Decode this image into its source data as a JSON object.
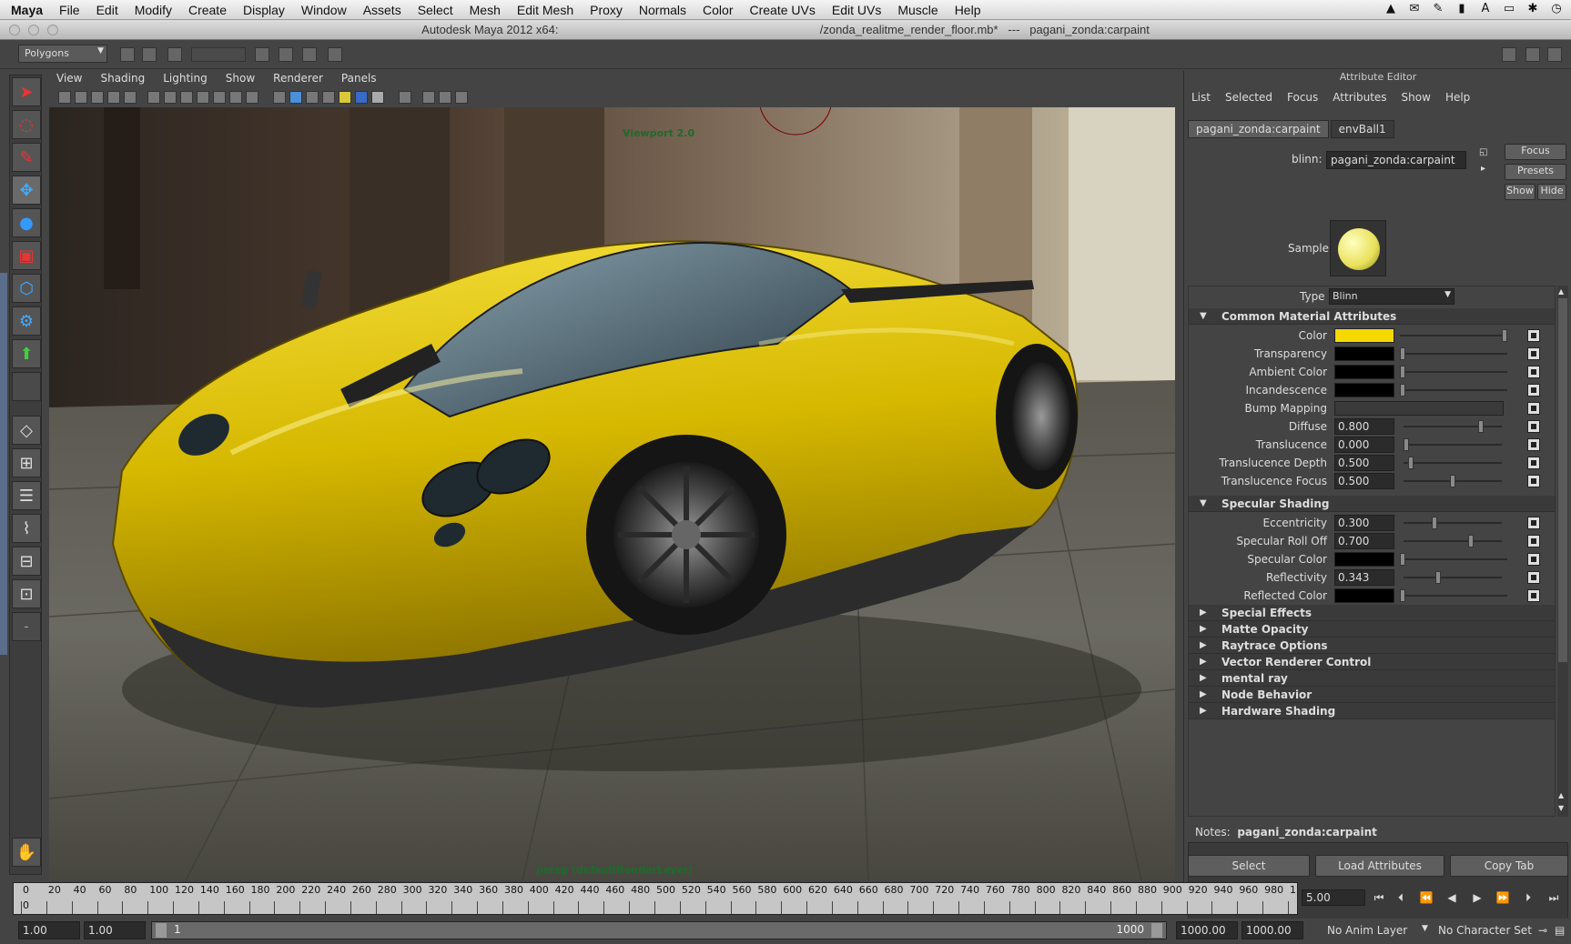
{
  "menubar": {
    "app": "Maya",
    "items": [
      "File",
      "Edit",
      "Modify",
      "Create",
      "Display",
      "Window",
      "Assets",
      "Select",
      "Mesh",
      "Edit Mesh",
      "Proxy",
      "Normals",
      "Color",
      "Create UVs",
      "Edit UVs",
      "Muscle",
      "Help"
    ]
  },
  "titlebar": {
    "app_title": "Autodesk Maya 2012 x64:",
    "file": "/zonda_realitme_render_floor.mb*",
    "sep": "---",
    "node": "pagani_zonda:carpaint"
  },
  "statusline": {
    "menu_set": "Polygons"
  },
  "panel": {
    "menu": [
      "View",
      "Shading",
      "Lighting",
      "Show",
      "Renderer",
      "Panels"
    ],
    "viewport_label": "Viewport 2.0",
    "camera_label": "persp (defaultRenderLayer)"
  },
  "attribute_editor": {
    "title": "Attribute Editor",
    "menu": [
      "List",
      "Selected",
      "Focus",
      "Attributes",
      "Show",
      "Help"
    ],
    "tabs": [
      "pagani_zonda:carpaint",
      "envBall1"
    ],
    "node_type_label": "blinn:",
    "node_name": "pagani_zonda:carpaint",
    "buttons": {
      "focus": "Focus",
      "presets": "Presets",
      "show": "Show",
      "hide": "Hide"
    },
    "sample_label": "Sample",
    "type_label": "Type",
    "type_value": "Blinn",
    "sections": {
      "common": "Common Material Attributes",
      "specular": "Specular Shading",
      "collapsed": [
        "Special Effects",
        "Matte Opacity",
        "Raytrace Options",
        "Vector Renderer Control",
        "mental ray",
        "Node Behavior",
        "Hardware Shading"
      ]
    },
    "common_attrs": [
      {
        "label": "Color",
        "swatch": "#f5d800",
        "level": 1.0
      },
      {
        "label": "Transparency",
        "swatch": "#000000",
        "level": 0.0
      },
      {
        "label": "Ambient Color",
        "swatch": "#000000",
        "level": 0.0
      },
      {
        "label": "Incandescence",
        "swatch": "#000000",
        "level": 0.0
      },
      {
        "label": "Bump Mapping"
      },
      {
        "label": "Diffuse",
        "value": "0.800",
        "level": 0.8
      },
      {
        "label": "Translucence",
        "value": "0.000",
        "level": 0.0
      },
      {
        "label": "Translucence Depth",
        "value": "0.500",
        "level": 0.05
      },
      {
        "label": "Translucence Focus",
        "value": "0.500",
        "level": 0.5
      }
    ],
    "specular_attrs": [
      {
        "label": "Eccentricity",
        "value": "0.300",
        "level": 0.3
      },
      {
        "label": "Specular Roll Off",
        "value": "0.700",
        "level": 0.7
      },
      {
        "label": "Specular Color",
        "swatch": "#000000",
        "level": 0.0
      },
      {
        "label": "Reflectivity",
        "value": "0.343",
        "level": 0.343
      },
      {
        "label": "Reflected Color",
        "swatch": "#000000",
        "level": 0.0
      }
    ],
    "notes_label": "Notes:",
    "notes_node": "pagani_zonda:carpaint",
    "bottom_buttons": [
      "Select",
      "Load Attributes",
      "Copy Tab"
    ]
  },
  "timeline": {
    "ticks": [
      "0",
      "20",
      "40",
      "60",
      "80",
      "100",
      "120",
      "140",
      "160",
      "180",
      "200",
      "220",
      "240",
      "260",
      "280",
      "300",
      "320",
      "340",
      "360",
      "380",
      "400",
      "420",
      "440",
      "460",
      "480",
      "500",
      "520",
      "540",
      "560",
      "580",
      "600",
      "620",
      "640",
      "660",
      "680",
      "700",
      "720",
      "740",
      "760",
      "780",
      "800",
      "820",
      "840",
      "860",
      "880",
      "900",
      "920",
      "940",
      "960",
      "980",
      "1"
    ],
    "current_frame": "5.00",
    "start_marker": "0"
  },
  "range": {
    "start": "1.00",
    "playback_start": "1.00",
    "range_start_label": "1",
    "range_end_label": "1000",
    "playback_end": "1000.00",
    "end": "1000.00",
    "anim_layer": "No Anim Layer",
    "character_set": "No Character Set"
  },
  "colors": {
    "car_yellow": "#e8cc00",
    "viewport_hud": "#1d6b2c"
  }
}
